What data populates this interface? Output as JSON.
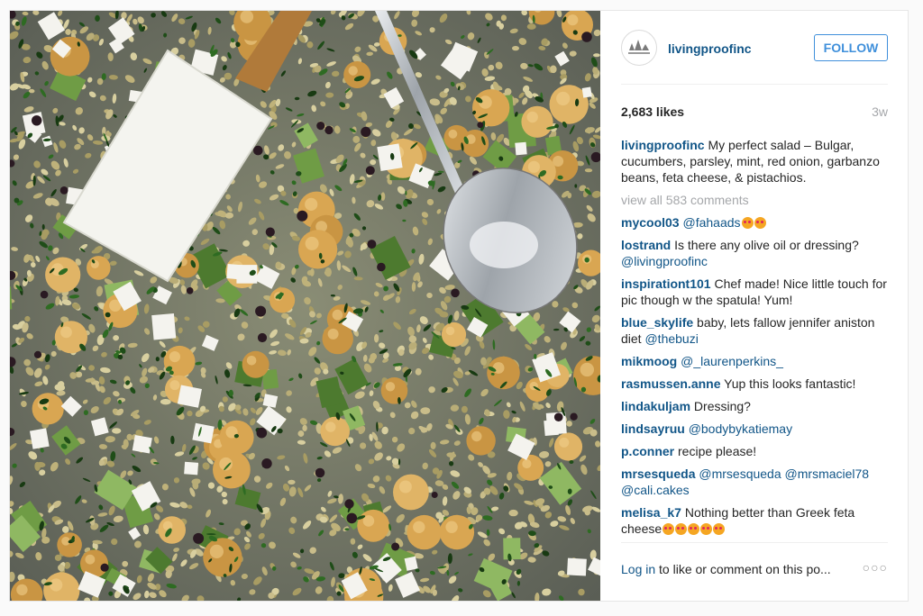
{
  "post": {
    "username": "livingproofinc",
    "follow_label": "FOLLOW",
    "likes": "2,683 likes",
    "time_ago": "3w",
    "caption_text": " My perfect salad – Bulgar, cucumbers, parsley, mint, red onion, garbanzo beans, feta cheese, & pistachios.",
    "view_all": "view all 583 comments",
    "comments": [
      {
        "user": "mycool03",
        "segments": [
          {
            "t": "mention",
            "v": "@fahaads"
          }
        ],
        "emoji_count": 2
      },
      {
        "user": "lostrand",
        "segments": [
          {
            "t": "text",
            "v": "Is there any olive oil or dressing? "
          },
          {
            "t": "mention",
            "v": "@livingproofinc"
          }
        ]
      },
      {
        "user": "inspirationt101",
        "segments": [
          {
            "t": "text",
            "v": "Chef made! Nice little touch for pic though w the spatula! Yum!"
          }
        ]
      },
      {
        "user": "blue_skylife",
        "segments": [
          {
            "t": "text",
            "v": "baby, lets fallow jennifer aniston diet "
          },
          {
            "t": "mention",
            "v": "@thebuzi"
          }
        ]
      },
      {
        "user": "mikmoog",
        "segments": [
          {
            "t": "mention",
            "v": "@_laurenperkins_"
          }
        ]
      },
      {
        "user": "rasmussen.anne",
        "segments": [
          {
            "t": "text",
            "v": "Yup this looks fantastic!"
          }
        ]
      },
      {
        "user": "lindakuljam",
        "segments": [
          {
            "t": "text",
            "v": "Dressing?"
          }
        ]
      },
      {
        "user": "lindsayruu",
        "segments": [
          {
            "t": "mention",
            "v": "@bodybykatiemay"
          }
        ]
      },
      {
        "user": "p.conner",
        "segments": [
          {
            "t": "text",
            "v": "recipe please!"
          }
        ]
      },
      {
        "user": "mrsesqueda",
        "segments": [
          {
            "t": "mention",
            "v": "@mrsesqueda"
          },
          {
            "t": "text",
            "v": " "
          },
          {
            "t": "mention",
            "v": "@mrsmaciel78"
          },
          {
            "t": "text",
            "v": " "
          },
          {
            "t": "mention",
            "v": "@cali.cakes"
          }
        ]
      },
      {
        "user": "melisa_k7",
        "segments": [
          {
            "t": "text",
            "v": "Nothing better than Greek feta cheese"
          }
        ],
        "emoji_count": 5
      }
    ],
    "login_link": "Log in",
    "login_text": " to like or comment on this po...",
    "more_label": "○○○"
  },
  "photo": {
    "subject": "salad-bowl-photo"
  },
  "colors": {
    "link": "#125688",
    "follow": "#4090db",
    "muted": "#a5a7aa"
  }
}
